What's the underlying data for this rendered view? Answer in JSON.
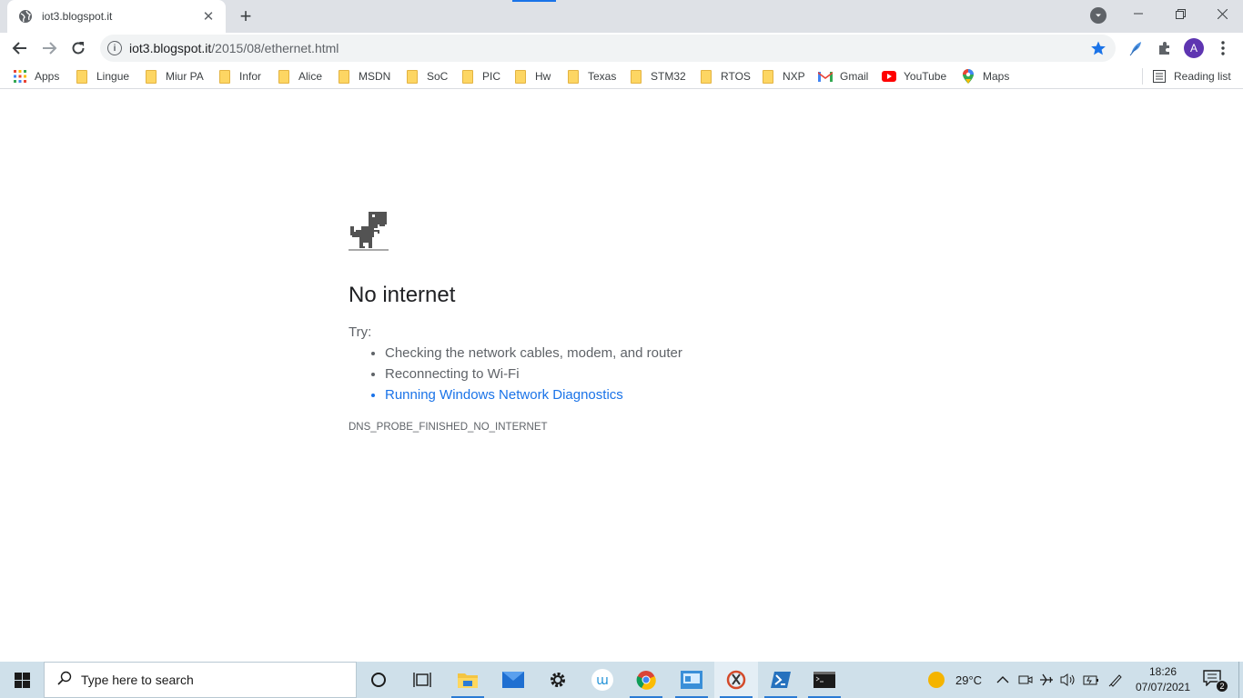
{
  "browser": {
    "tab": {
      "title": "iot3.blogspot.it",
      "favicon": "globe-icon"
    },
    "omnibox": {
      "host": "iot3.blogspot.it",
      "path": "/2015/08/ethernet.html",
      "bookmarked": true
    },
    "profile_initial": "A",
    "accent_color": "#1a73e8"
  },
  "bookmarks": {
    "items": [
      {
        "label": "Apps",
        "icon": "apps-grid-icon"
      },
      {
        "label": "Lingue",
        "icon": "folder-icon"
      },
      {
        "label": "Miur PA",
        "icon": "folder-icon"
      },
      {
        "label": "Infor",
        "icon": "folder-icon"
      },
      {
        "label": "Alice",
        "icon": "folder-icon"
      },
      {
        "label": "MSDN",
        "icon": "folder-icon"
      },
      {
        "label": "SoC",
        "icon": "folder-icon"
      },
      {
        "label": "PIC",
        "icon": "folder-icon"
      },
      {
        "label": "Hw",
        "icon": "folder-icon"
      },
      {
        "label": "Texas",
        "icon": "folder-icon"
      },
      {
        "label": "STM32",
        "icon": "folder-icon"
      },
      {
        "label": "RTOS",
        "icon": "folder-icon"
      },
      {
        "label": "NXP",
        "icon": "folder-icon"
      },
      {
        "label": "Gmail",
        "icon": "gmail-icon"
      },
      {
        "label": "YouTube",
        "icon": "youtube-icon"
      },
      {
        "label": "Maps",
        "icon": "maps-icon"
      }
    ],
    "reading_list": "Reading list"
  },
  "error_page": {
    "title": "No internet",
    "try_label": "Try:",
    "suggestions": [
      "Checking the network cables, modem, and router",
      "Reconnecting to Wi-Fi",
      "Running Windows Network Diagnostics"
    ],
    "error_code": "DNS_PROBE_FINISHED_NO_INTERNET"
  },
  "taskbar": {
    "search_placeholder": "Type here to search",
    "weather": "29°C",
    "time": "18:26",
    "date": "07/07/2021",
    "notification_count": "2",
    "color": "#cfe0ea"
  }
}
